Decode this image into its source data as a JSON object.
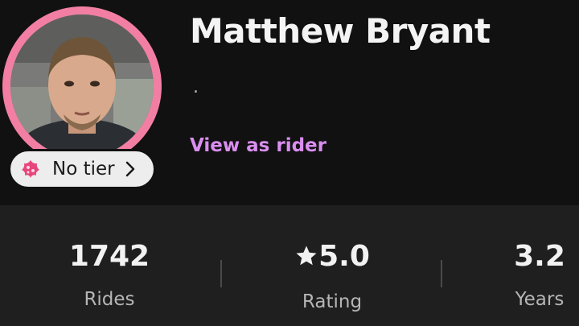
{
  "profile": {
    "name": "Matthew Bryant",
    "subline": ".",
    "view_as_rider": "View as rider",
    "tier": {
      "label": "No tier",
      "icon": "tier-badge-icon",
      "chevron_icon": "chevron-right-icon"
    },
    "avatar_icon": "profile-photo"
  },
  "stats": [
    {
      "value": "1742",
      "label": "Rides"
    },
    {
      "value": "5.0",
      "label": "Rating",
      "icon": "star-icon"
    },
    {
      "value": "3.2",
      "label": "Years"
    }
  ],
  "colors": {
    "background": "#111111",
    "stats_background": "#1f1f1f",
    "ring": "#f27fa3",
    "accent_link": "#d98ef0",
    "tier_icon": "#e8457a"
  }
}
